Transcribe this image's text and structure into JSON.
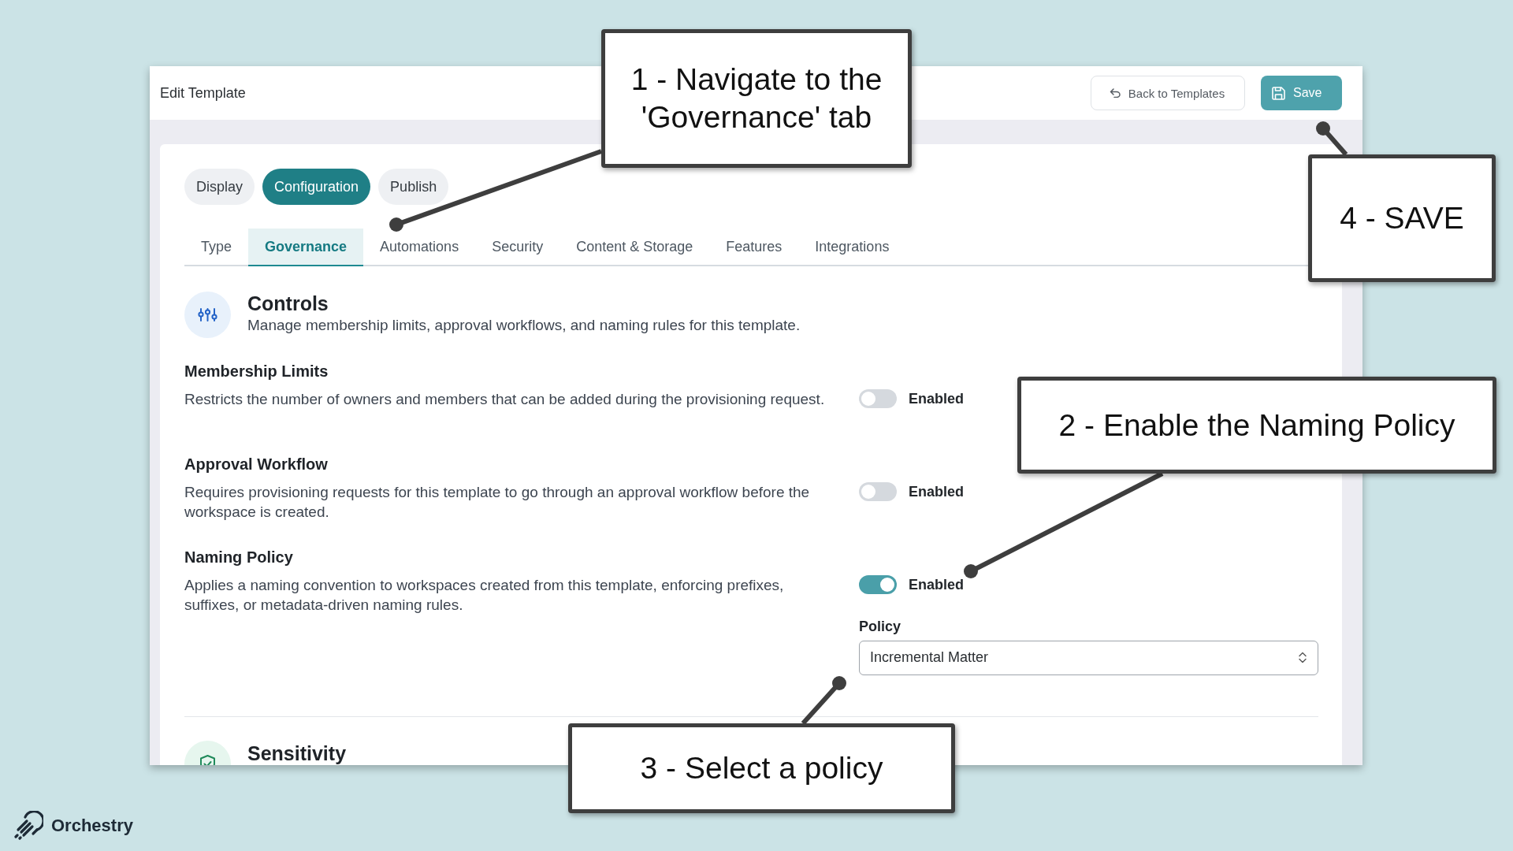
{
  "window": {
    "title": "Edit Template",
    "buttons": [
      {
        "kind": "secondary",
        "label": "Back to Templates"
      },
      {
        "kind": "primary",
        "label": "Save"
      }
    ]
  },
  "top_tabs": [
    {
      "label": "Display",
      "selected": false
    },
    {
      "label": "Configuration",
      "selected": true
    },
    {
      "label": "Publish",
      "selected": false
    }
  ],
  "sub_tabs": [
    {
      "label": "Type",
      "selected": false
    },
    {
      "label": "Governance",
      "selected": true
    },
    {
      "label": "Automations",
      "selected": false
    },
    {
      "label": "Security",
      "selected": false
    },
    {
      "label": "Content & Storage",
      "selected": false
    },
    {
      "label": "Features",
      "selected": false
    },
    {
      "label": "Integrations",
      "selected": false
    }
  ],
  "controls": {
    "title": "Controls",
    "description": "Manage membership limits, approval workflows, and naming rules for this template."
  },
  "settings": [
    {
      "title": "Membership Limits",
      "description": "Restricts the number of owners and members that can be added during the provisioning request.",
      "toggle_label": "Enabled",
      "on": false
    },
    {
      "title": "Approval Workflow",
      "description": "Requires provisioning requests for this template to go through an approval workflow before the workspace is created.",
      "toggle_label": "Enabled",
      "on": false
    },
    {
      "title": "Naming Policy",
      "description": "Applies a naming convention to workspaces created from this template, enforcing prefixes, suffixes, or metadata-driven naming rules.",
      "toggle_label": "Enabled",
      "on": true,
      "field": {
        "label": "Policy",
        "value": "Incremental Matter"
      }
    }
  ],
  "next_section": {
    "title": "Sensitivity"
  },
  "callouts": [
    {
      "lines": [
        "1 - Navigate to the",
        "'Governance' tab"
      ]
    },
    {
      "lines": [
        "2 - Enable the Naming Policy"
      ]
    },
    {
      "lines": [
        "3 - Select a policy"
      ]
    },
    {
      "lines": [
        "4 - SAVE"
      ]
    }
  ],
  "brand": {
    "name": "Orchestry"
  }
}
